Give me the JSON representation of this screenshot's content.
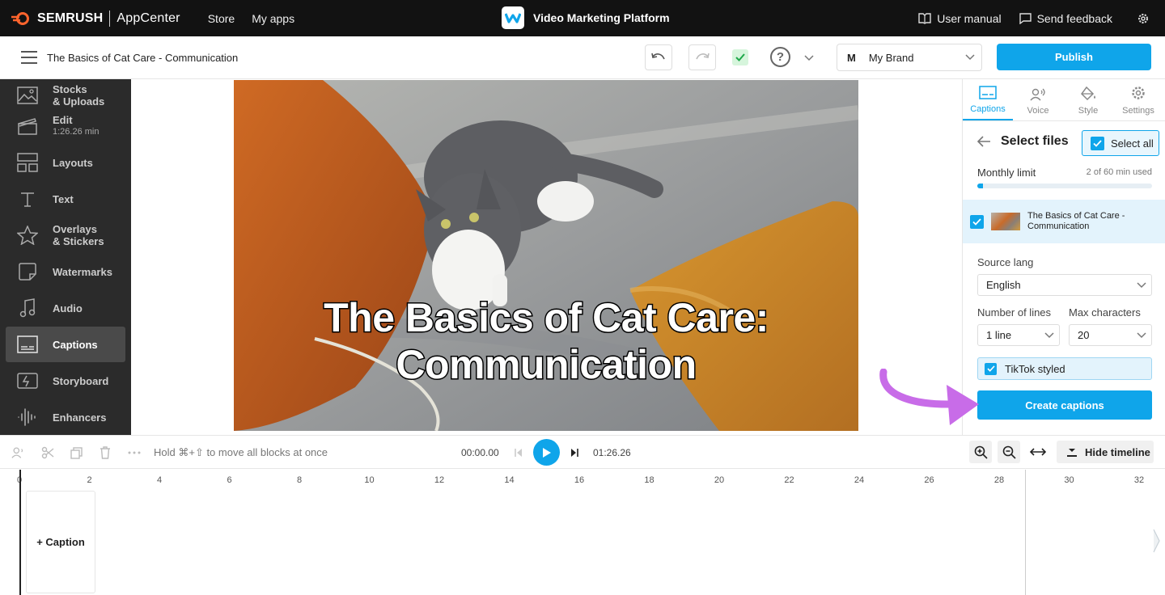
{
  "topbar": {
    "brand": "SEMRUSH",
    "appcenter": "AppCenter",
    "nav": [
      "Store",
      "My apps"
    ],
    "app_title": "Video Marketing Platform",
    "user_manual": "User manual",
    "send_feedback": "Send feedback"
  },
  "toolbar": {
    "doc_title": "The Basics of Cat Care - Communication",
    "brand_initial": "M",
    "brand_name": "My Brand",
    "publish": "Publish"
  },
  "sidebar": {
    "items": [
      {
        "label": "Stocks",
        "label2": "& Uploads",
        "icon": "image-icon"
      },
      {
        "label": "Edit",
        "sub": "1:26.26 min",
        "icon": "clapper-icon"
      },
      {
        "label": "Layouts",
        "icon": "layout-icon"
      },
      {
        "label": "Text",
        "icon": "text-icon"
      },
      {
        "label": "Overlays",
        "label2": "& Stickers",
        "icon": "star-icon"
      },
      {
        "label": "Watermarks",
        "icon": "watermark-icon"
      },
      {
        "label": "Audio",
        "icon": "music-icon"
      },
      {
        "label": "Captions",
        "icon": "captions-icon",
        "active": true
      },
      {
        "label": "Storyboard",
        "icon": "storyboard-icon"
      },
      {
        "label": "Enhancers",
        "icon": "waveform-icon"
      }
    ]
  },
  "canvas": {
    "caption_line1": "The Basics of Cat Care:",
    "caption_line2": "Communication"
  },
  "panel": {
    "tabs": [
      {
        "label": "Captions",
        "icon": "captions-icon",
        "active": true
      },
      {
        "label": "Voice",
        "icon": "voice-icon"
      },
      {
        "label": "Style",
        "icon": "paint-bucket-icon"
      },
      {
        "label": "Settings",
        "icon": "gear-icon"
      }
    ],
    "select_files": "Select files",
    "select_all": "Select all",
    "monthly_limit": "Monthly limit",
    "limit_used": "2 of 60 min used",
    "limit_fraction": 0.033,
    "file_name_line1": "The Basics of Cat Care -",
    "file_name_line2": "Communication",
    "source_lang_label": "Source lang",
    "source_lang_value": "English",
    "lines_label": "Number of lines",
    "lines_value": "1 line",
    "maxchars_label": "Max characters",
    "maxchars_value": "20",
    "tiktok": "TikTok styled",
    "create": "Create captions"
  },
  "timeline": {
    "hint": "Hold ⌘+⇧ to move all blocks at once",
    "current_time": "00:00.00",
    "total_time": "01:26.26",
    "hide_timeline": "Hide timeline",
    "ruler_ticks": [
      "0",
      "2",
      "4",
      "6",
      "8",
      "10",
      "12",
      "14",
      "16",
      "18",
      "20",
      "22",
      "24",
      "26",
      "28",
      "30",
      "32"
    ],
    "add_caption": "+ Caption"
  },
  "colors": {
    "accent": "#0fa5ea",
    "sidebar_bg": "#2b2b2b",
    "arrow": "#c86ce8"
  }
}
